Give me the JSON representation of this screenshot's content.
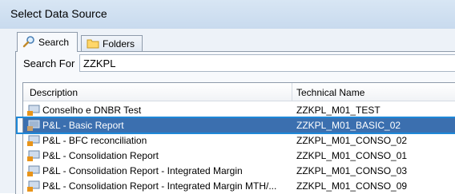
{
  "window": {
    "title": "Select Data Source"
  },
  "tabs": [
    {
      "label": "Search",
      "icon": "magnifier-icon"
    },
    {
      "label": "Folders",
      "icon": "folder-icon"
    }
  ],
  "search": {
    "label": "Search For",
    "value": "ZZKPL"
  },
  "table": {
    "columns": [
      "Description",
      "Technical Name"
    ],
    "rows": [
      {
        "description": "Conselho e DNBR Test",
        "technical_name": "ZZKPL_M01_TEST"
      },
      {
        "description": "P&L - Basic Report",
        "technical_name": "ZZKPL_M01_BASIC_02"
      },
      {
        "description": "P&L - BFC reconciliation",
        "technical_name": "ZZKPL_M01_CONSO_02"
      },
      {
        "description": "P&L - Consolidation Report",
        "technical_name": "ZZKPL_M01_CONSO_01"
      },
      {
        "description": "P&L - Consolidation Report - Integrated Margin",
        "technical_name": "ZZKPL_M01_CONSO_03"
      },
      {
        "description": "P&L - Consolidation Report - Integrated Margin MTH/...",
        "technical_name": "ZZKPL_M01_CONSO_09"
      }
    ]
  },
  "colors": {
    "selection": "#3b6faf",
    "highlight_outline": "#1e88d8",
    "icon_accent": "#e8941a"
  }
}
